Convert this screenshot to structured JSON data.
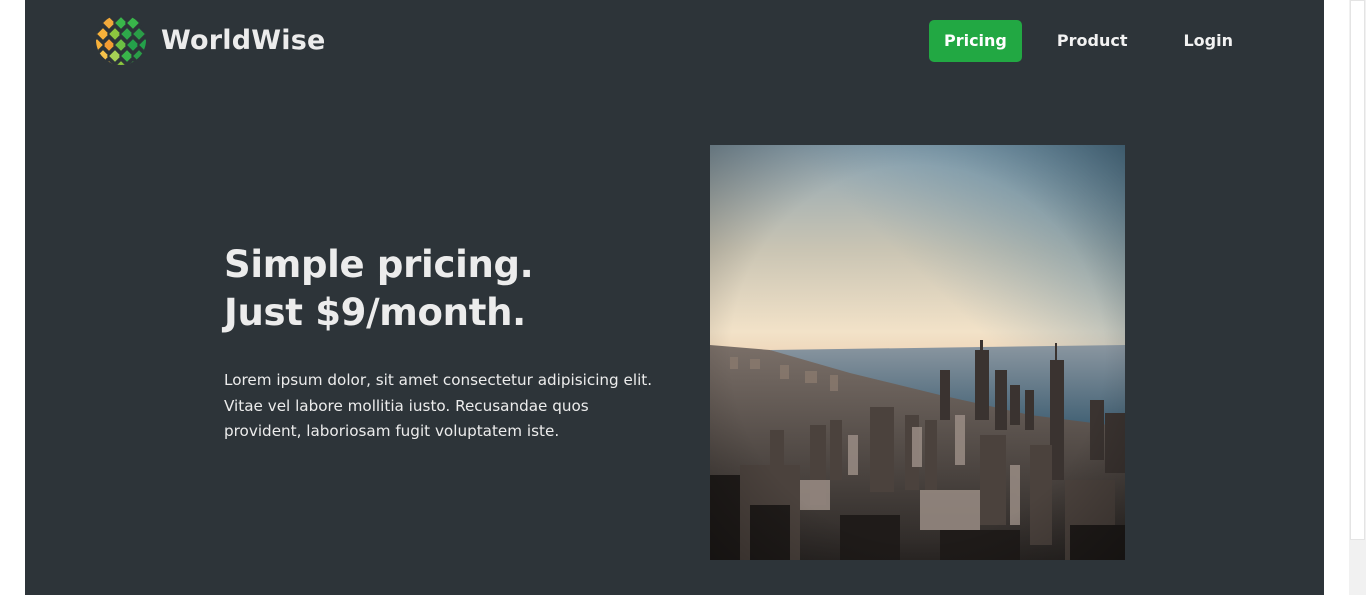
{
  "header": {
    "logo_text": "WorldWise",
    "nav": {
      "pricing": "Pricing",
      "product": "Product",
      "login": "Login"
    }
  },
  "hero": {
    "title_line1": "Simple pricing.",
    "title_line2": "Just $9/month.",
    "description": "Lorem ipsum dolor, sit amet consectetur adipisicing elit. Vitae vel labore mollitia iusto. Recusandae quos provident, laboriosam fugit voluptatem iste."
  },
  "colors": {
    "background": "#2d3439",
    "accent": "#22a843",
    "text": "#ececec"
  },
  "icons": {
    "logo": "globe-logo-icon"
  }
}
